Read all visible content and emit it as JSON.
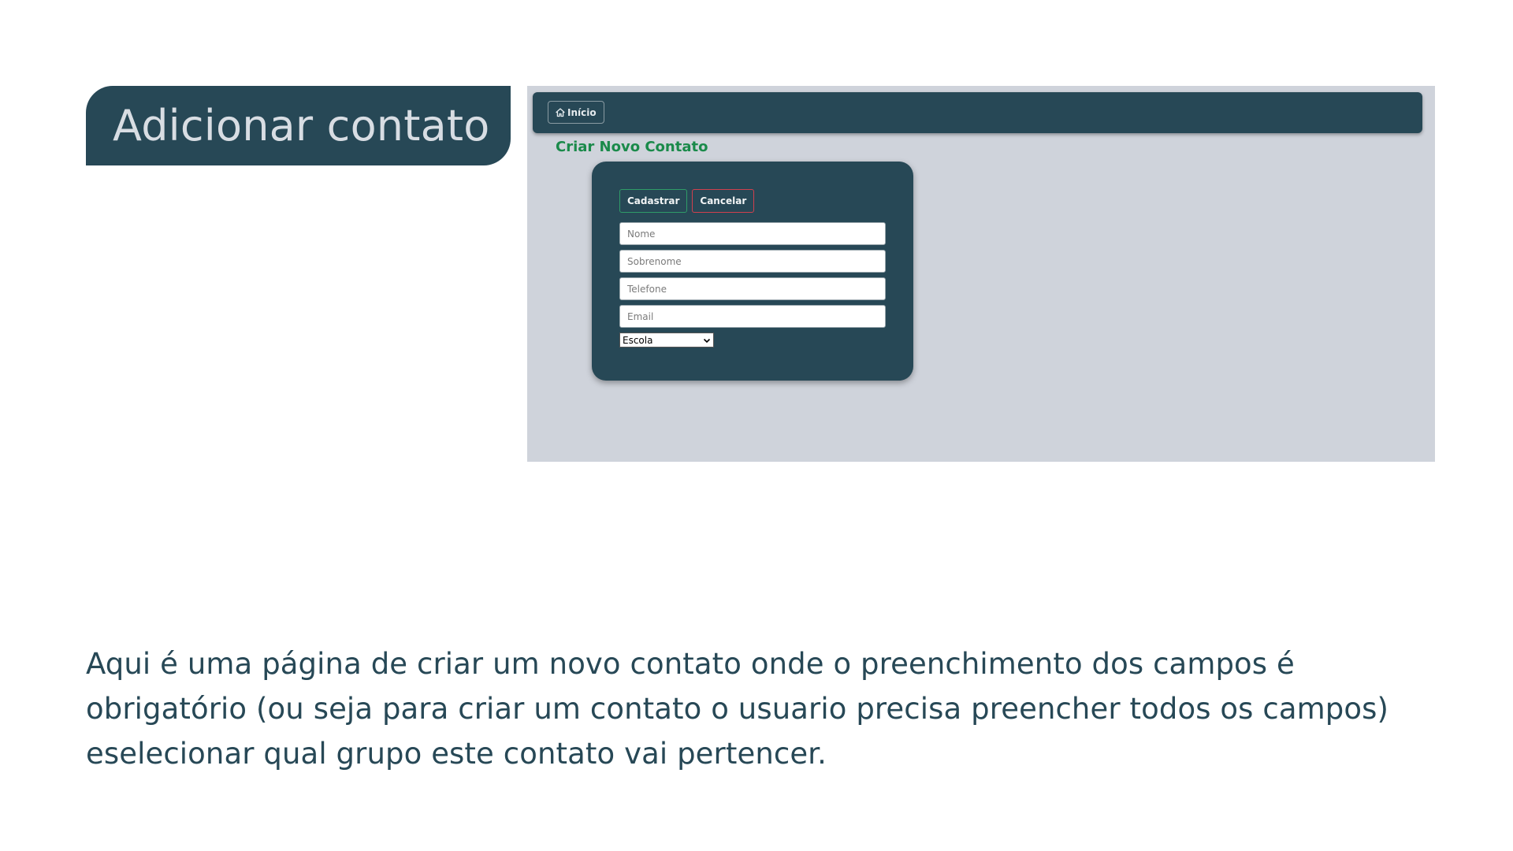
{
  "slide": {
    "title": "Adicionar contato",
    "caption": "Aqui é uma página de criar um novo contato onde o preenchimento dos campos é obrigatório (ou seja para criar um contato o usuario precisa preencher todos os campos) eselecionar qual grupo este contato vai pertencer."
  },
  "app": {
    "nav": {
      "home_label": "Início",
      "home_icon": "home-icon"
    },
    "heading": "Criar Novo Contato",
    "form": {
      "save_label": "Cadastrar",
      "cancel_label": "Cancelar",
      "fields": {
        "nome_placeholder": "Nome",
        "sobrenome_placeholder": "Sobrenome",
        "telefone_placeholder": "Telefone",
        "email_placeholder": "Email"
      },
      "group_select_value": "Escola"
    }
  },
  "colors": {
    "brand_dark": "#274856",
    "heading_green": "#1a8a4a",
    "save_border": "#2f9c68",
    "cancel_border": "#d0404e",
    "screenshot_bg": "#cfd3db"
  }
}
